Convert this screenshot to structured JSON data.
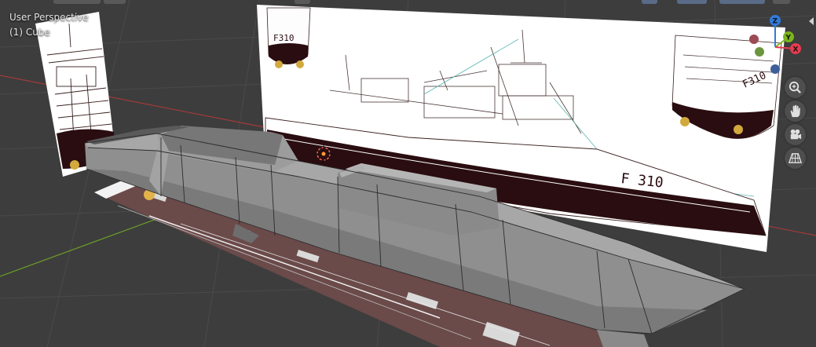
{
  "viewport": {
    "perspective_label": "User Perspective",
    "object_label": "(1) Cube"
  },
  "gizmo": {
    "axes": {
      "z": {
        "label": "Z",
        "color": "#2f7bdc"
      },
      "y": {
        "label": "Y",
        "color": "#7bb51b"
      },
      "x": {
        "label": "X",
        "color": "#e8394f"
      }
    },
    "neg_colors": {
      "x": "#9c4a55",
      "y": "#5d8a2a",
      "z": "#3d5f99"
    }
  },
  "nav_tools": [
    {
      "name": "zoom-icon",
      "tool": "zoom"
    },
    {
      "name": "hand-pan-icon",
      "tool": "pan"
    },
    {
      "name": "camera-icon",
      "tool": "camera"
    },
    {
      "name": "grid-ortho-icon",
      "tool": "ortho"
    }
  ],
  "reference": {
    "hull_number": "F310",
    "hull_number_small": "F 310",
    "hull_number_bow": "F310"
  },
  "colors": {
    "viewport_bg": "#3d3d3d",
    "grid_line": "#4a4a4a",
    "x_axis": "#a33a3a",
    "y_axis": "#6a9a2a",
    "hull": "#8f8f8f",
    "deck": "#6f6f6f",
    "reference_paper": "#ffffff",
    "reference_dark": "#2a0d10",
    "deck_plan": "#6b4a4a",
    "cursor_orange": "#ff9a2e"
  }
}
